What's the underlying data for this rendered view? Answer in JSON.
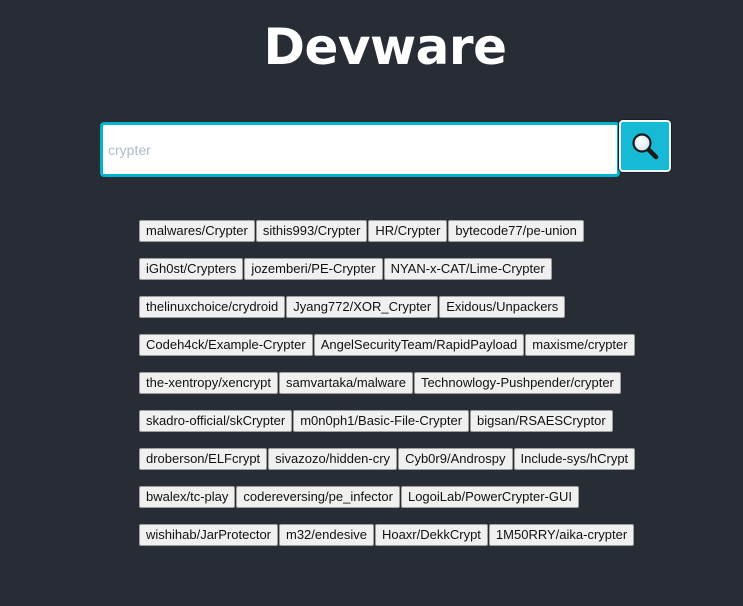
{
  "app": {
    "title": "Devware"
  },
  "search": {
    "value": "",
    "placeholder": "crypter",
    "button_icon": "magnifier-icon"
  },
  "results": [
    [
      "malwares/Crypter",
      "sithis993/Crypter",
      "HR/Crypter",
      "bytecode77/pe-union"
    ],
    [
      "iGh0st/Crypters",
      "jozemberi/PE-Crypter",
      "NYAN-x-CAT/Lime-Crypter"
    ],
    [
      "thelinuxchoice/crydroid",
      "Jyang772/XOR_Crypter",
      "Exidous/Unpackers"
    ],
    [
      "Codeh4ck/Example-Crypter",
      "AngelSecurityTeam/RapidPayload",
      "maxisme/crypter"
    ],
    [
      "the-xentropy/xencrypt",
      "samvartaka/malware",
      "Technowlogy-Pushpender/crypter"
    ],
    [
      "skadro-official/skCrypter",
      "m0n0ph1/Basic-File-Crypter",
      "bigsan/RSAESCryptor"
    ],
    [
      "droberson/ELFcrypt",
      "sivazozo/hidden-cry",
      "Cyb0r9/Androspy",
      "Include-sys/hCrypt"
    ],
    [
      "bwalex/tc-play",
      "codereversing/pe_infector",
      "LogoiLab/PowerCrypter-GUI"
    ],
    [
      "wishihab/JarProtector",
      "m32/endesive",
      "Hoaxr/DekkCrypt",
      "1M50RRY/aika-crypter"
    ]
  ],
  "colors": {
    "background": "#282c34",
    "accent": "#16bad4",
    "input_border": "#00b4d0",
    "title": "#ffffff"
  }
}
